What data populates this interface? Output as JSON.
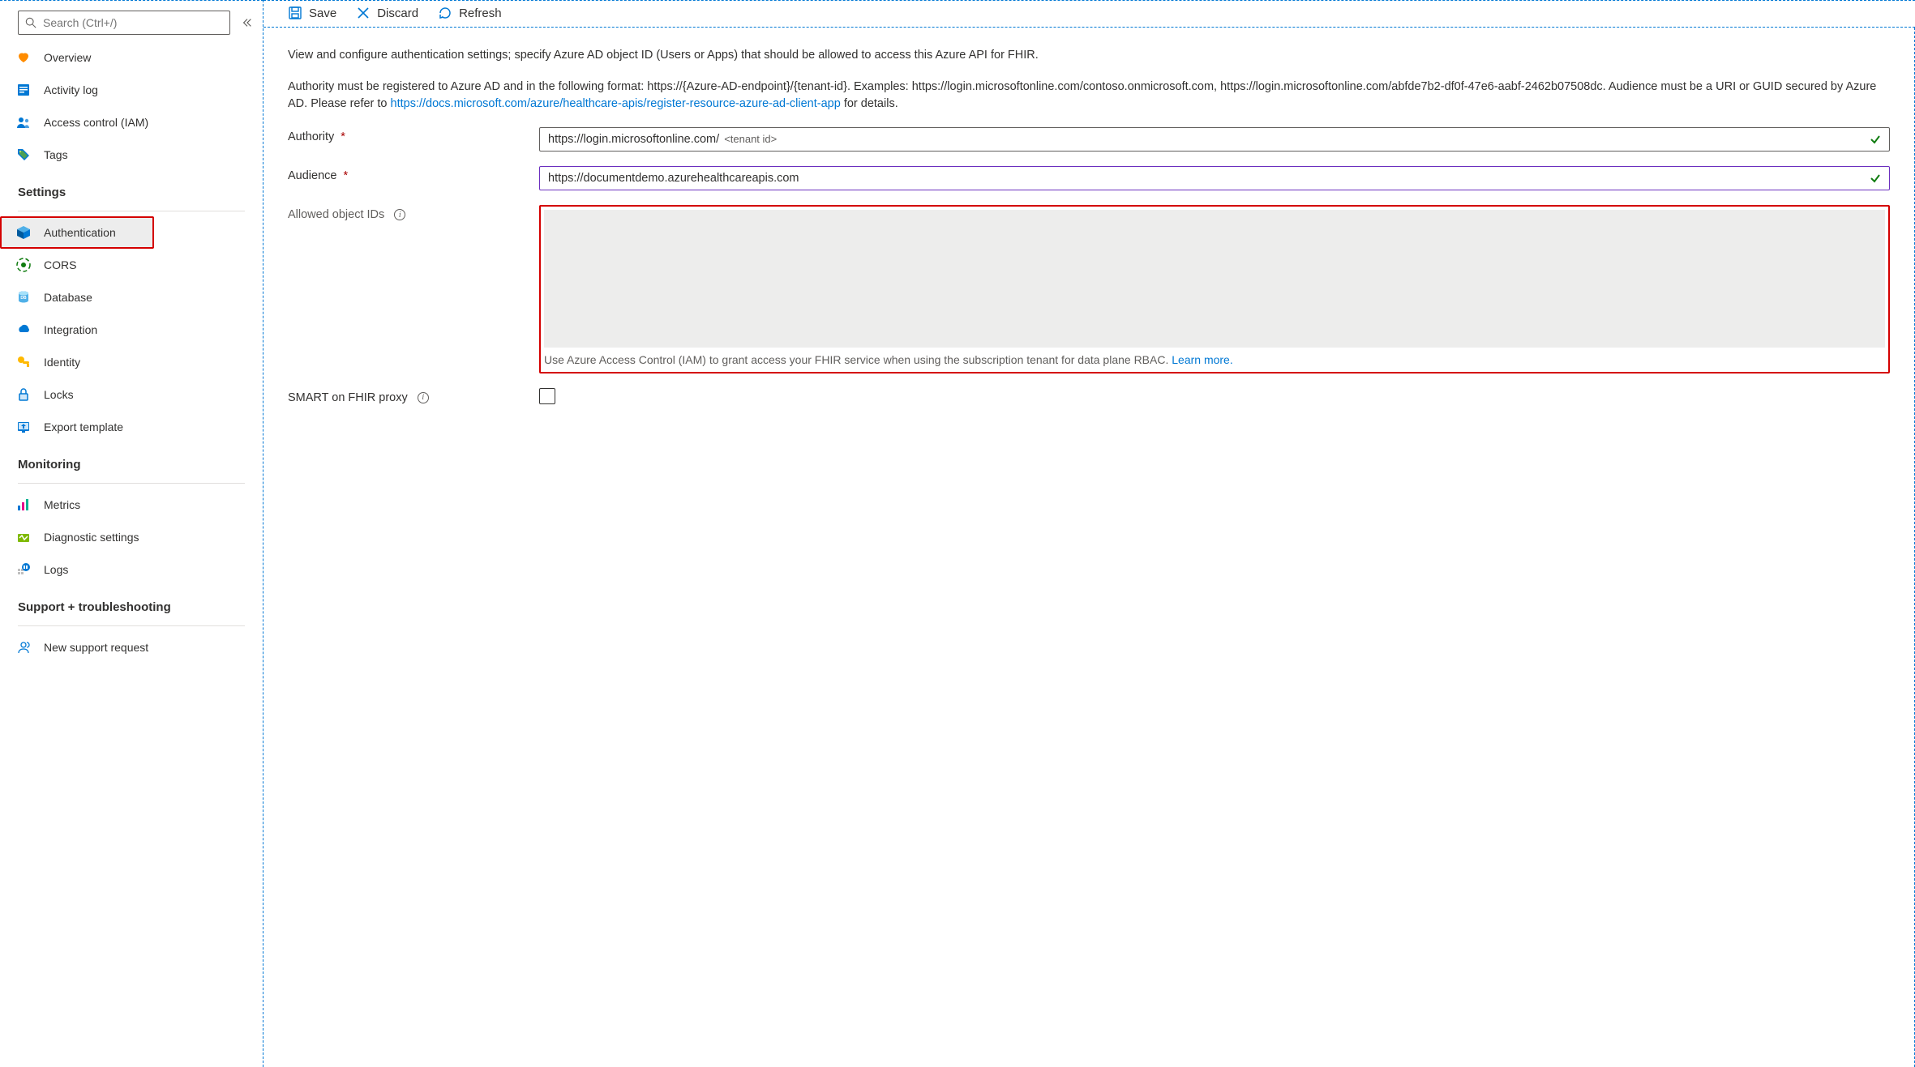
{
  "search": {
    "placeholder": "Search (Ctrl+/)"
  },
  "sidebar": {
    "top": [
      {
        "label": "Overview"
      },
      {
        "label": "Activity log"
      },
      {
        "label": "Access control (IAM)"
      },
      {
        "label": "Tags"
      }
    ],
    "groups": {
      "settings": "Settings",
      "monitoring": "Monitoring",
      "support": "Support + troubleshooting"
    },
    "settings": [
      {
        "label": "Authentication"
      },
      {
        "label": "CORS"
      },
      {
        "label": "Database"
      },
      {
        "label": "Integration"
      },
      {
        "label": "Identity"
      },
      {
        "label": "Locks"
      },
      {
        "label": "Export template"
      }
    ],
    "monitoring": [
      {
        "label": "Metrics"
      },
      {
        "label": "Diagnostic settings"
      },
      {
        "label": "Logs"
      }
    ],
    "support": [
      {
        "label": "New support request"
      }
    ]
  },
  "toolbar": {
    "save": "Save",
    "discard": "Discard",
    "refresh": "Refresh"
  },
  "intro": {
    "p1": "View and configure authentication settings; specify Azure AD object ID (Users or Apps) that should be allowed to access this Azure API for FHIR.",
    "p2a": "Authority must be registered to Azure AD and in the following format: https://{Azure-AD-endpoint}/{tenant-id}. Examples: https://login.microsoftonline.com/contoso.onmicrosoft.com, https://login.microsoftonline.com/abfde7b2-df0f-47e6-aabf-2462b07508dc. Audience must be a URI or GUID secured by Azure AD. Please refer to ",
    "p2link": "https://docs.microsoft.com/azure/healthcare-apis/register-resource-azure-ad-client-app",
    "p2b": " for details."
  },
  "form": {
    "authority": {
      "label": "Authority",
      "value": "https://login.microsoftonline.com/",
      "hint": "<tenant id>"
    },
    "audience": {
      "label": "Audience",
      "value": "https://documentdemo.azurehealthcareapis.com"
    },
    "allowed": {
      "label": "Allowed object IDs",
      "helper_a": "Use Azure Access Control (IAM) to grant access your FHIR service when using the subscription tenant for data plane RBAC. ",
      "helper_link": "Learn more."
    },
    "smart": {
      "label": "SMART on FHIR proxy"
    }
  }
}
